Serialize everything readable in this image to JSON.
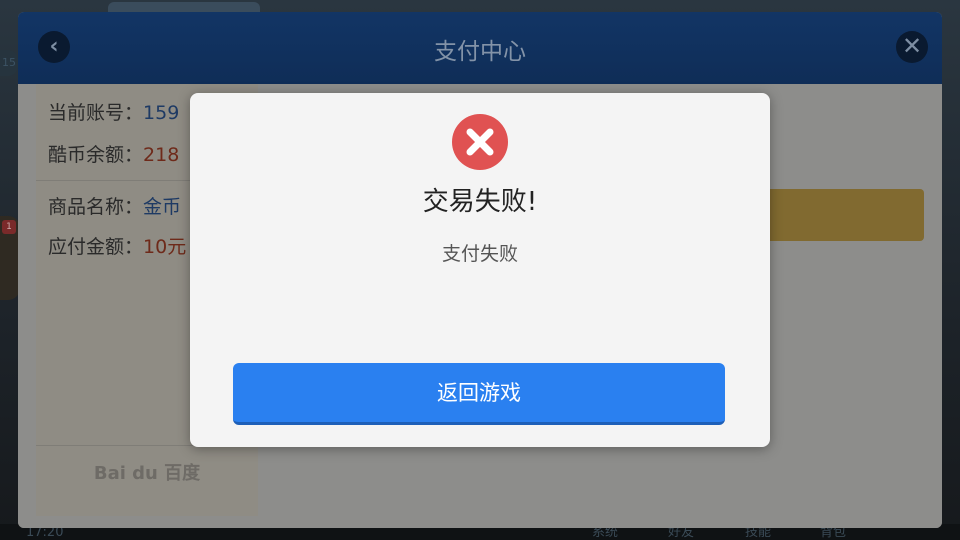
{
  "background": {
    "left_badge": "15",
    "left_notification": "1",
    "bottom_time": "17:20",
    "bottom_tabs": [
      "系统",
      "好友",
      "技能",
      "背包"
    ]
  },
  "payment_window": {
    "title": "支付中心",
    "back_icon": "chevron-left-icon",
    "close_icon": "close-icon",
    "info": {
      "account_label": "当前账号：",
      "account_value": "159",
      "balance_label": "酷币余额：",
      "balance_value": "218",
      "product_label": "商品名称：",
      "product_value": "金币",
      "amount_label": "应付金额：",
      "amount_value": "10元"
    },
    "baidu_logo": "Bai du 百度"
  },
  "modal": {
    "icon": "error-x-icon",
    "title": "交易失败!",
    "message": "支付失败",
    "return_button": "返回游戏"
  },
  "colors": {
    "header": "#123565",
    "modal_bg": "#f4f4f4",
    "error_red": "#e05252",
    "button_blue": "#2a80f0"
  }
}
